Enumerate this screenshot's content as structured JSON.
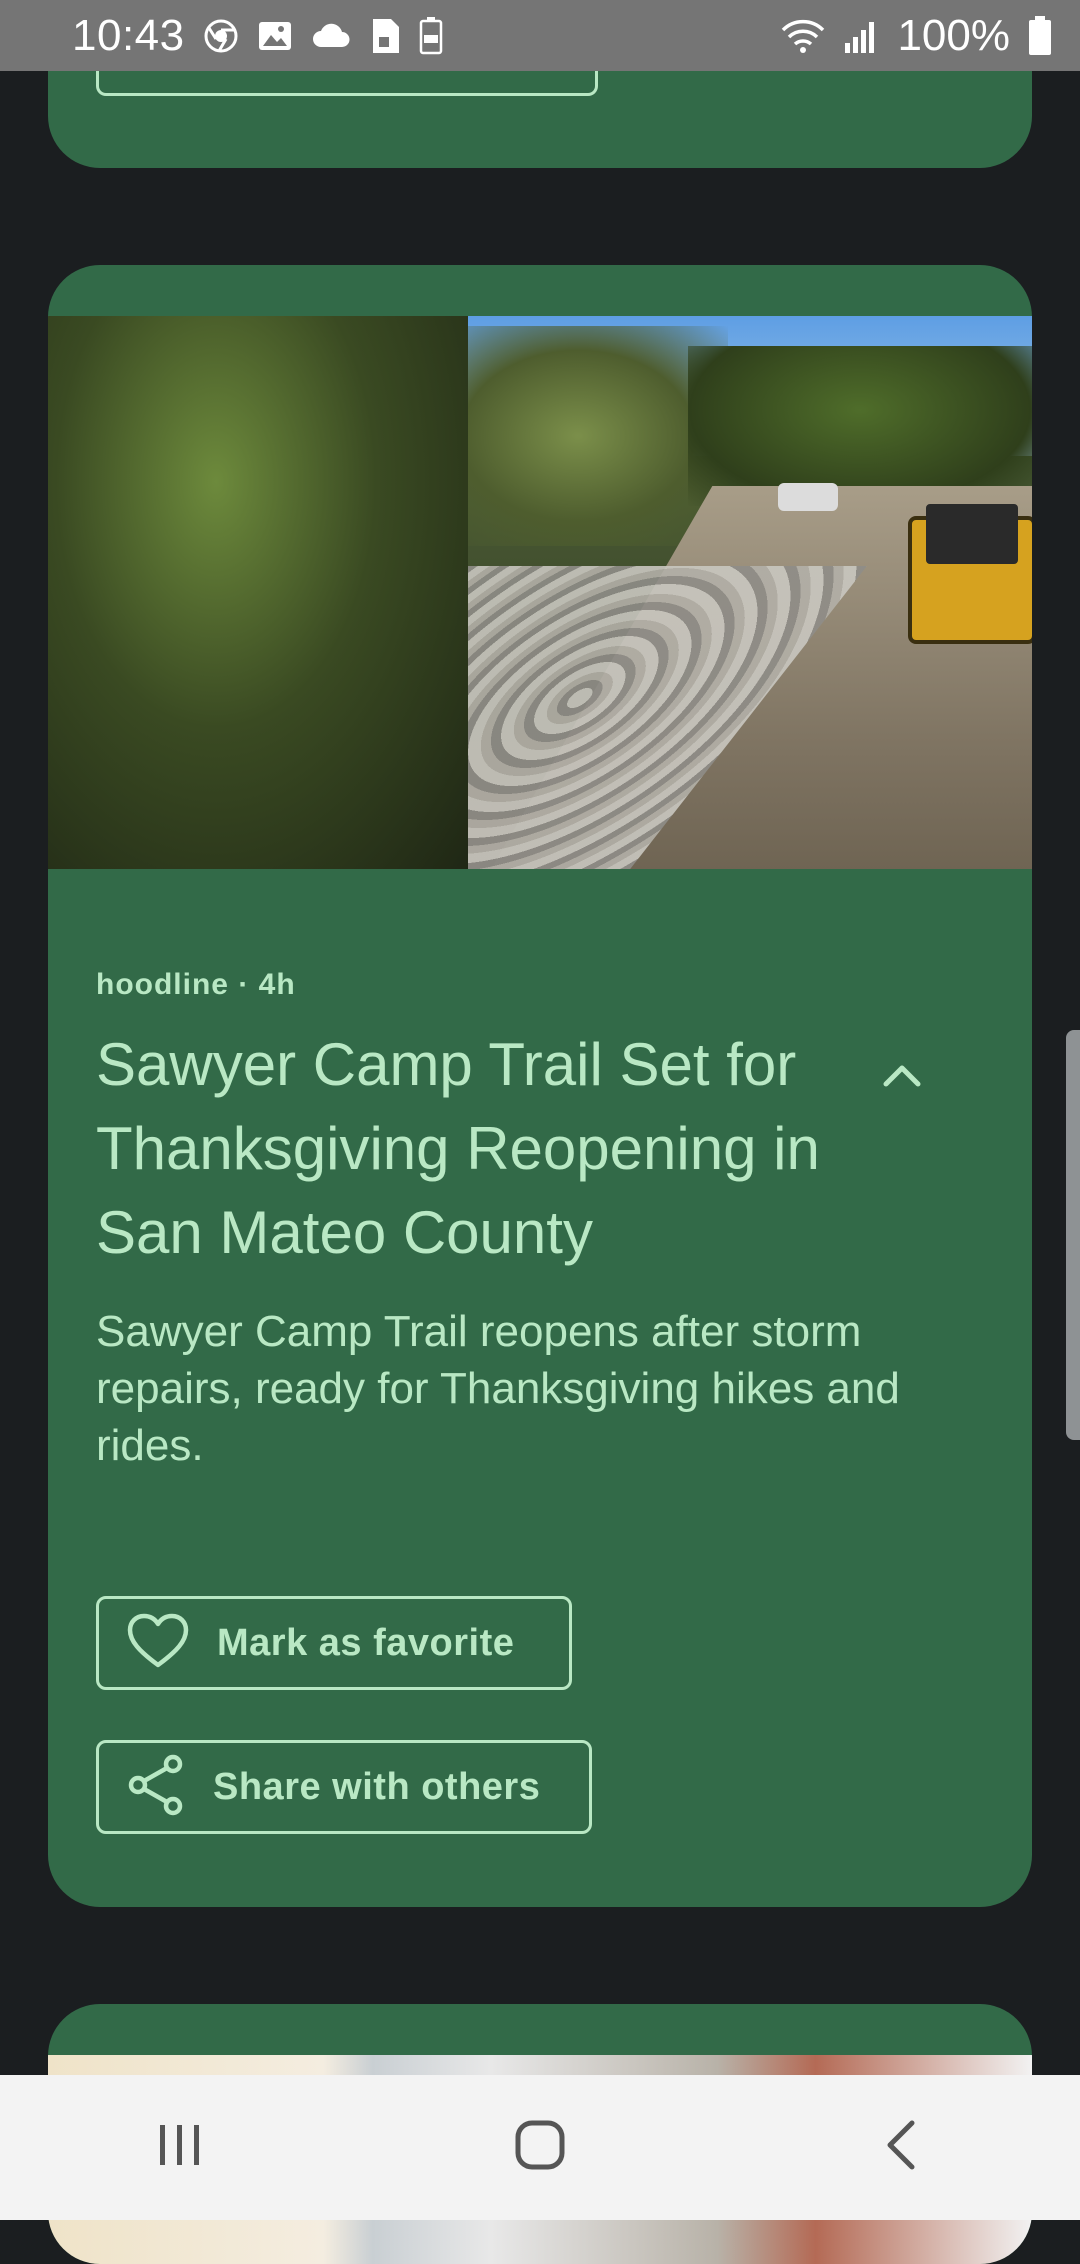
{
  "status_bar": {
    "time": "10:43",
    "battery_text": "100%",
    "left_icons": [
      "chrome-icon",
      "gallery-icon",
      "cloud-icon",
      "sim-icon",
      "battery-saver-icon"
    ],
    "right_icons": [
      "wifi-icon",
      "signal-icon",
      "battery-icon"
    ]
  },
  "article": {
    "meta": "hoodline · 4h",
    "title": "Sawyer Camp Trail Set for Thanksgiving Reopening in San Mateo County",
    "summary": "Sawyer Camp Trail reopens after storm repairs, ready for Thanksgiving hikes and rides.",
    "favorite_label": "Mark as favorite",
    "share_label": "Share with others"
  },
  "colors": {
    "card": "#326a48",
    "text": "#b9e8c4",
    "background": "#1b1e20",
    "status_bar": "#757575",
    "nav_bar": "#f3f3f3"
  },
  "nav_bar": {
    "buttons": [
      "recent-apps-icon",
      "home-icon",
      "back-icon"
    ]
  }
}
